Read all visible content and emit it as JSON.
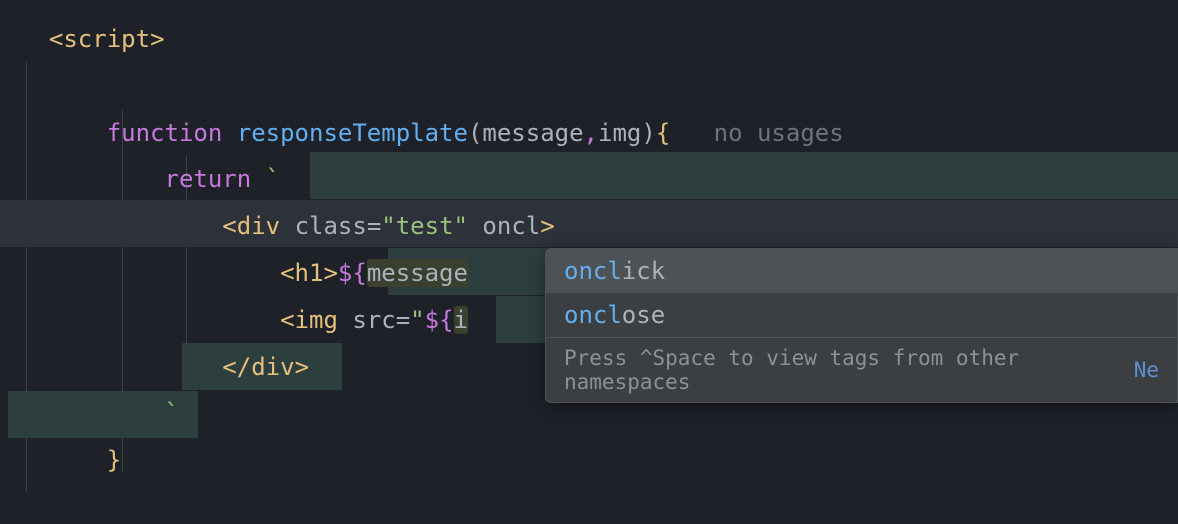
{
  "code": {
    "line1": {
      "open": "<",
      "tag": "script",
      "close": ">"
    },
    "line3": {
      "keyword": "function",
      "funcName": "responseTemplate",
      "openParen": "(",
      "param1": "message",
      "comma": ",",
      "param2": "img",
      "closeParen": ")",
      "openBrace": "{",
      "hint": "no usages"
    },
    "line4": {
      "keyword": "return",
      "backtick": "`"
    },
    "line5": {
      "open": "<",
      "tag": "div",
      "attr1": "class",
      "eq": "=",
      "val1": "\"test\"",
      "attr2": "oncl",
      "close": ">"
    },
    "line6": {
      "open": "<",
      "tag": "h1",
      "close": ">",
      "dollarOpen": "${",
      "var": "message"
    },
    "line7": {
      "open": "<",
      "tag": "img",
      "attr": "src",
      "eq": "=",
      "quote": "\"",
      "dollarOpen": "${",
      "var": "i"
    },
    "line8": {
      "open": "</",
      "tag": "div",
      "close": ">"
    },
    "line9": {
      "backtick": "`"
    },
    "line10": {
      "closeBrace": "}"
    }
  },
  "autocomplete": {
    "item1": {
      "match": "oncl",
      "rest": "ick"
    },
    "item2": {
      "match": "oncl",
      "rest": "ose"
    },
    "footer": "Press ^Space to view tags from other namespaces",
    "footerLink": "Ne"
  }
}
